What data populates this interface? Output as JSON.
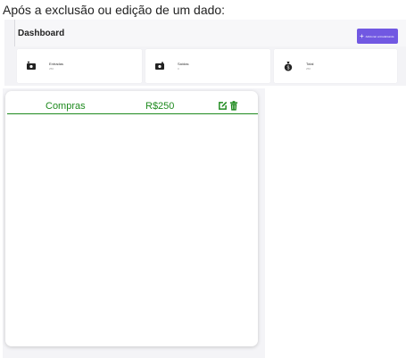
{
  "heading": "Após a exclusão ou edição de um dado:",
  "dashboard": {
    "title": "Dashboard",
    "add_button": "Adicionar entrada/saída"
  },
  "cards": [
    {
      "label": "Entradas",
      "value": "250",
      "icon": "cash-in-icon"
    },
    {
      "label": "Saídas",
      "value": "0",
      "icon": "cash-out-icon"
    },
    {
      "label": "Total",
      "value": "250",
      "icon": "money-bag-icon"
    }
  ],
  "transactions": [
    {
      "name": "Compras",
      "value": "R$250"
    }
  ],
  "colors": {
    "accent": "#7158e2",
    "entry_green": "#1e8a1e"
  }
}
